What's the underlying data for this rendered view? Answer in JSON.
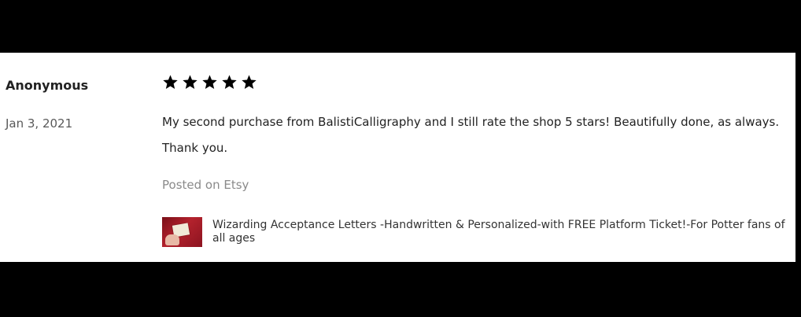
{
  "review": {
    "reviewer": "Anonymous",
    "date": "Jan 3, 2021",
    "rating": {
      "value": 5,
      "max": 5
    },
    "text": "My second purchase from BalistiCalligraphy and I still rate the shop 5 stars! Beautifully done, as always. Thank you.",
    "posted_on": "Posted on Etsy",
    "product": {
      "title": "Wizarding Acceptance Letters -Handwritten & Personalized-with FREE Platform Ticket!-For Potter fans of all ages",
      "thumbnail_icon": "product-thumbnail"
    }
  },
  "colors": {
    "background": "#000000",
    "card": "#ffffff",
    "text": "#222222",
    "muted": "#8a8a8a",
    "star": "#000000"
  }
}
